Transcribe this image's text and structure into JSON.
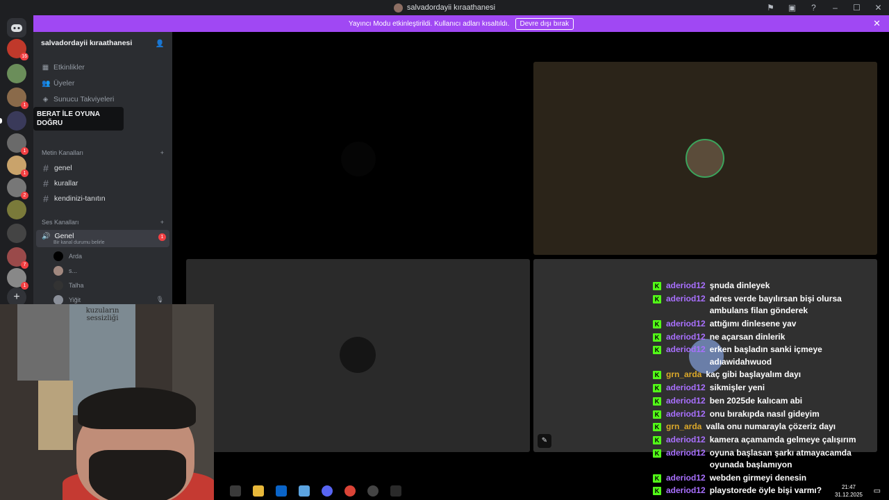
{
  "window": {
    "title": "salvadordayii kıraathanesi"
  },
  "banner": {
    "message": "Yayıncı Modu etkinleştirildi. Kullanıcı adları kısaltıldı.",
    "button_label": "Devre dışı bırak"
  },
  "servers": [
    {
      "badge": "16"
    },
    {
      "badge": ""
    },
    {
      "badge": "1"
    },
    {
      "badge": ""
    },
    {
      "badge": "1"
    },
    {
      "badge": "1"
    },
    {
      "badge": "2"
    },
    {
      "badge": ""
    },
    {
      "badge": ""
    },
    {
      "badge": "7"
    },
    {
      "badge": "1"
    }
  ],
  "sidebar": {
    "server_name": "salvadordayii kıraathanesi",
    "menu": [
      "Etkinlikler",
      "Üyeler",
      "Sunucu Takviyeleri"
    ],
    "tooltip": "BERAT İLE OYUNA DOĞRU",
    "text_category": "Metin Kanalları",
    "text_channels": [
      "genel",
      "kurallar",
      "kendinizi-tanıtın"
    ],
    "voice_category": "Ses Kanalları",
    "voice_channel": {
      "name": "Genel",
      "status": "Bir kanal durumu belirle",
      "badge": "1"
    },
    "voice_users": [
      "Arda",
      "s...",
      "Talha",
      "Yiğit"
    ]
  },
  "webcam": {
    "poster_title": "kuzuların sessizliği"
  },
  "taskbar": {
    "time": "21:47",
    "date": "31.12.2025"
  },
  "colors": {
    "purple_user": "#a970ff",
    "gold_user": "#dba82a",
    "kick_green": "#53fc18"
  },
  "chat": [
    {
      "user": "aderiod12",
      "color": "#a970ff",
      "text": "şnuda dinleyek"
    },
    {
      "user": "aderiod12",
      "color": "#a970ff",
      "text": "adres verde bayılırsan bişi olursa ambulans filan gönderek"
    },
    {
      "user": "aderiod12",
      "color": "#a970ff",
      "text": "attığımı dinlesene yav"
    },
    {
      "user": "aderiod12",
      "color": "#a970ff",
      "text": "ne açarsan dinlerik"
    },
    {
      "user": "aderiod12",
      "color": "#a970ff",
      "text": "erken başladın sanki içmeye adıawidahwuod"
    },
    {
      "user": "grn_arda",
      "color": "#dba82a",
      "text": "kaç gibi başlayalım dayı"
    },
    {
      "user": "aderiod12",
      "color": "#a970ff",
      "text": "sikmişler yeni"
    },
    {
      "user": "aderiod12",
      "color": "#a970ff",
      "text": "ben 2025de kalıcam abi"
    },
    {
      "user": "aderiod12",
      "color": "#a970ff",
      "text": "onu bırakıpda nasıl gideyim"
    },
    {
      "user": "grn_arda",
      "color": "#dba82a",
      "text": "valla onu numarayla çözeriz dayı"
    },
    {
      "user": "aderiod12",
      "color": "#a970ff",
      "text": "kamera açamamda gelmeye çalışırım"
    },
    {
      "user": "aderiod12",
      "color": "#a970ff",
      "text": "oyuna başlasan şarkı atmayacamda oyunada başlamıyon"
    },
    {
      "user": "aderiod12",
      "color": "#a970ff",
      "text": "webden girmeyi denesin"
    },
    {
      "user": "aderiod12",
      "color": "#a970ff",
      "text": "playstorede öyle bişi varmı?"
    }
  ]
}
